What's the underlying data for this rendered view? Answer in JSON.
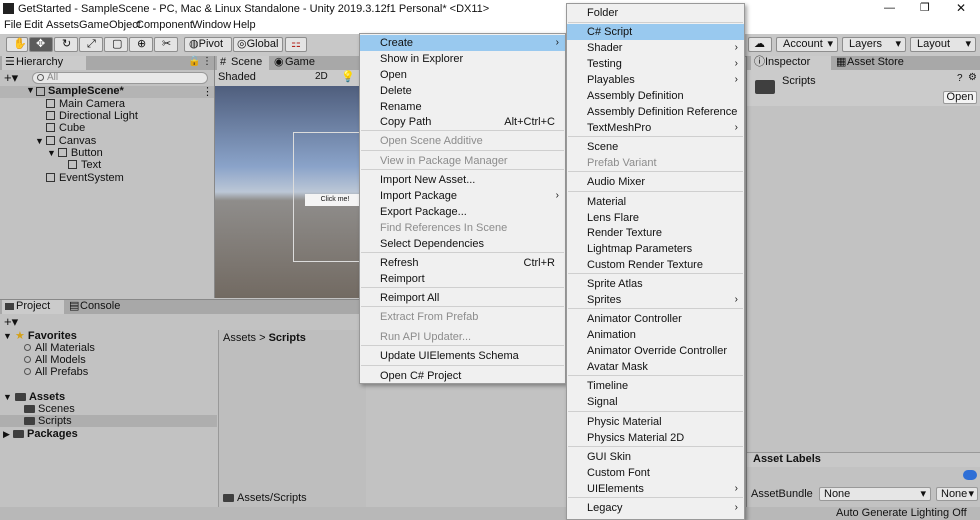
{
  "window": {
    "title": "GetStarted - SampleScene - PC, Mac & Linux Standalone - Unity 2019.3.12f1 Personal* <DX11>",
    "controls": {
      "minimize": "—",
      "restore": "❐",
      "close": "✕"
    }
  },
  "menubar": [
    "File",
    "Edit",
    "Assets",
    "GameObject",
    "Component",
    "Window",
    "Help"
  ],
  "toolbar": {
    "pivot_label": "Pivot",
    "global_label": "Global",
    "account_label": "Account",
    "layers_label": "Layers",
    "layout_label": "Layout"
  },
  "hierarchy": {
    "tab_label": "Hierarchy",
    "search_placeholder": "All",
    "scene_name": "SampleScene*",
    "items": [
      "Main Camera",
      "Directional Light",
      "Cube",
      "Canvas",
      "Button",
      "Text",
      "EventSystem"
    ]
  },
  "scene": {
    "tab_scene": "Scene",
    "tab_game": "Game",
    "shading_mode": "Shaded",
    "mode_2d": "2D",
    "button_text": "Click me!"
  },
  "project": {
    "tab_project": "Project",
    "tab_console": "Console",
    "favorites_label": "Favorites",
    "favorites": [
      "All Materials",
      "All Models",
      "All Prefabs"
    ],
    "assets_label": "Assets",
    "asset_folders": [
      "Scenes",
      "Scripts"
    ],
    "packages_label": "Packages",
    "breadcrumb_root": "Assets",
    "breadcrumb_current": "Scripts",
    "footer_path": "Assets/Scripts"
  },
  "inspector": {
    "tab_inspector": "Inspector",
    "tab_asset_store": "Asset Store",
    "folder_name": "Scripts",
    "open_button": "Open",
    "asset_labels": "Asset Labels",
    "assetbundle_label": "AssetBundle",
    "assetbundle_value": "None",
    "variant_value": "None"
  },
  "status_bar": {
    "text": "Auto Generate Lighting Off"
  },
  "context_menu": {
    "items": [
      {
        "label": "Create",
        "submenu": true,
        "highlighted": true
      },
      {
        "label": "Show in Explorer"
      },
      {
        "label": "Open"
      },
      {
        "label": "Delete"
      },
      {
        "label": "Rename"
      },
      {
        "label": "Copy Path",
        "shortcut": "Alt+Ctrl+C"
      },
      {
        "label": "Open Scene Additive",
        "disabled": true
      },
      {
        "label": "View in Package Manager",
        "disabled": true
      },
      {
        "label": "Import New Asset..."
      },
      {
        "label": "Import Package",
        "submenu": true
      },
      {
        "label": "Export Package..."
      },
      {
        "label": "Find References In Scene",
        "disabled": true
      },
      {
        "label": "Select Dependencies"
      },
      {
        "label": "Refresh",
        "shortcut": "Ctrl+R"
      },
      {
        "label": "Reimport"
      },
      {
        "label": "Reimport All"
      },
      {
        "label": "Extract From Prefab",
        "disabled": true
      },
      {
        "label": "Run API Updater...",
        "disabled": true
      },
      {
        "label": "Update UIElements Schema"
      },
      {
        "label": "Open C# Project"
      }
    ]
  },
  "create_submenu": {
    "items": [
      {
        "label": "Folder"
      },
      {
        "label": "C# Script",
        "highlighted": true
      },
      {
        "label": "Shader",
        "submenu": true
      },
      {
        "label": "Testing",
        "submenu": true
      },
      {
        "label": "Playables",
        "submenu": true
      },
      {
        "label": "Assembly Definition"
      },
      {
        "label": "Assembly Definition Reference"
      },
      {
        "label": "TextMeshPro",
        "submenu": true
      },
      {
        "label": "Scene"
      },
      {
        "label": "Prefab Variant",
        "disabled": true
      },
      {
        "label": "Audio Mixer"
      },
      {
        "label": "Material"
      },
      {
        "label": "Lens Flare"
      },
      {
        "label": "Render Texture"
      },
      {
        "label": "Lightmap Parameters"
      },
      {
        "label": "Custom Render Texture"
      },
      {
        "label": "Sprite Atlas"
      },
      {
        "label": "Sprites",
        "submenu": true
      },
      {
        "label": "Animator Controller"
      },
      {
        "label": "Animation"
      },
      {
        "label": "Animator Override Controller"
      },
      {
        "label": "Avatar Mask"
      },
      {
        "label": "Timeline"
      },
      {
        "label": "Signal"
      },
      {
        "label": "Physic Material"
      },
      {
        "label": "Physics Material 2D"
      },
      {
        "label": "GUI Skin"
      },
      {
        "label": "Custom Font"
      },
      {
        "label": "UIElements",
        "submenu": true
      },
      {
        "label": "Legacy",
        "submenu": true
      }
    ]
  },
  "colors": {
    "highlight": "#99c9ef",
    "panel": "#c2c2c2",
    "selection": "#8fa8c8"
  }
}
